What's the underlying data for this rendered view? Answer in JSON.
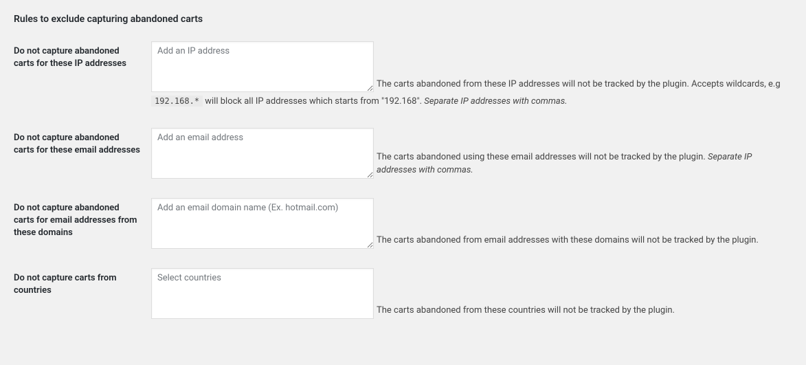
{
  "section_title": "Rules to exclude capturing abandoned carts",
  "rows": {
    "ip": {
      "label": "Do not capture abandoned carts for these IP addresses",
      "placeholder": "Add an IP address",
      "desc_prefix": "The carts abandoned from these IP addresses will not be tracked by the plugin. Accepts wildcards, e.g ",
      "code": "192.168.*",
      "desc_mid": " will block all IP addresses which starts from \"192.168\". ",
      "desc_em": "Separate IP addresses with commas."
    },
    "email": {
      "label": "Do not capture abandoned carts for these email addresses",
      "placeholder": "Add an email address",
      "desc_prefix": "The carts abandoned using these email addresses will not be tracked by the plugin. ",
      "desc_em": "Separate IP addresses with commas."
    },
    "domain": {
      "label": "Do not capture abandoned carts for email addresses from these domains",
      "placeholder": "Add an email domain name (Ex. hotmail.com)",
      "desc": "The carts abandoned from email addresses with these domains will not be tracked by the plugin."
    },
    "country": {
      "label": "Do not capture carts from countries",
      "placeholder": "Select countries",
      "desc": "The carts abandoned from these countries will not be tracked by the plugin."
    }
  }
}
